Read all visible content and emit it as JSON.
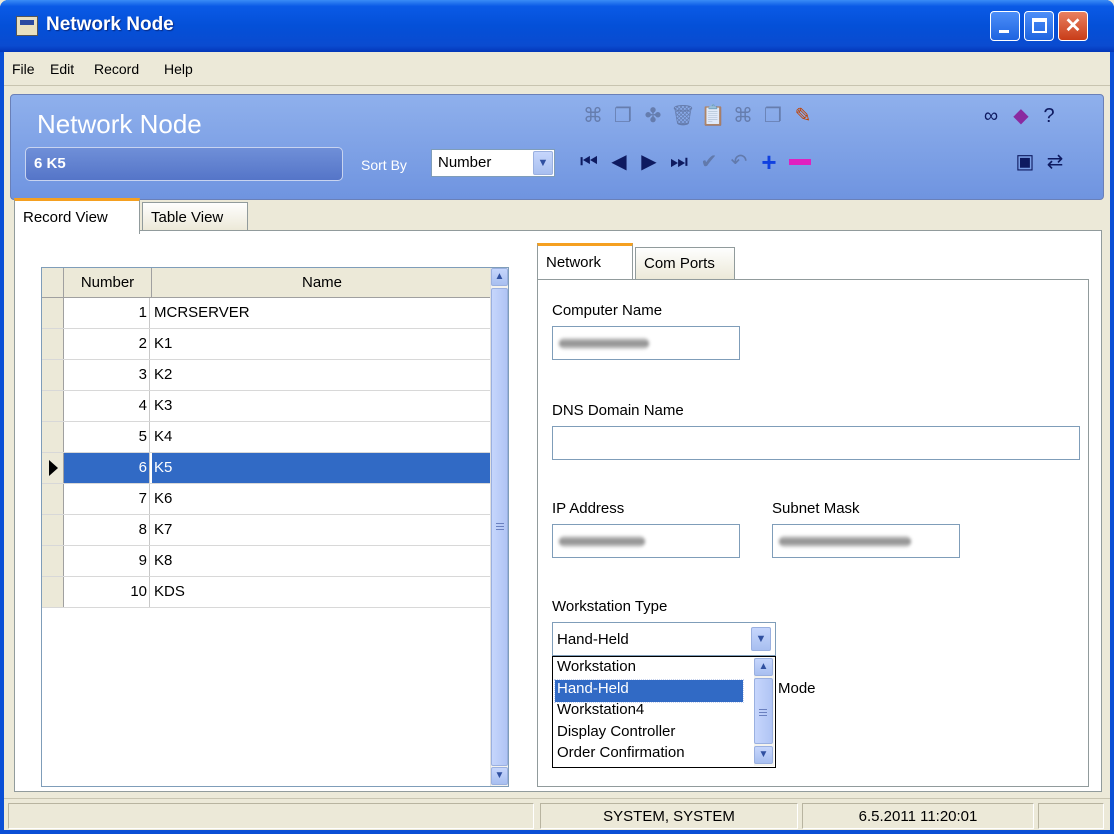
{
  "window": {
    "title": "Network Node"
  },
  "menu": {
    "file": "File",
    "edit": "Edit",
    "record": "Record",
    "help": "Help"
  },
  "header": {
    "title": "Network Node",
    "current_record": "6 K5",
    "sort_by_label": "Sort By",
    "sort_by_value": "Number"
  },
  "toolbar_icons": [
    "find-icon",
    "copy-icon",
    "replace-icon",
    "delete-icon",
    "paste-icon",
    "find-record-icon",
    "copy-record-icon",
    "clear-icon",
    "binoculars-icon",
    "book-icon",
    "help-pointer-icon",
    "first-record-icon",
    "previous-record-icon",
    "next-record-icon",
    "last-record-icon",
    "confirm-icon",
    "undo-icon",
    "add-record-icon",
    "remove-record-icon",
    "display-icon",
    "transfer-icon"
  ],
  "tabs": {
    "record_view": "Record View",
    "table_view": "Table View"
  },
  "grid": {
    "columns": [
      "Number",
      "Name"
    ],
    "rows": [
      {
        "number": "1",
        "name": "MCRSERVER"
      },
      {
        "number": "2",
        "name": "K1"
      },
      {
        "number": "3",
        "name": "K2"
      },
      {
        "number": "4",
        "name": "K3"
      },
      {
        "number": "5",
        "name": "K4"
      },
      {
        "number": "6",
        "name": "K5"
      },
      {
        "number": "7",
        "name": "K6"
      },
      {
        "number": "8",
        "name": "K7"
      },
      {
        "number": "9",
        "name": "K8"
      },
      {
        "number": "10",
        "name": "KDS"
      }
    ],
    "selected_index": 5
  },
  "detail_tabs": {
    "network": "Network",
    "com_ports": "Com Ports"
  },
  "network": {
    "computer_name_label": "Computer Name",
    "dns_domain_label": "DNS Domain Name",
    "dns_domain_value": "",
    "ip_address_label": "IP Address",
    "subnet_mask_label": "Subnet Mask",
    "workstation_type_label": "Workstation Type",
    "workstation_type_value": "Hand-Held",
    "workstation_type_options": [
      "Workstation",
      "Hand-Held",
      "Workstation4",
      "Display Controller",
      "Order Confirmation"
    ],
    "partial_label": "Mode"
  },
  "status": {
    "user": "SYSTEM, SYSTEM",
    "datetime": "6.5.2011 11:20:01"
  },
  "colors": {
    "title_blue": "#0450d8",
    "header_blue": "#7f9fe6",
    "selection": "#316ac5",
    "tab_accent": "#f5a020"
  }
}
